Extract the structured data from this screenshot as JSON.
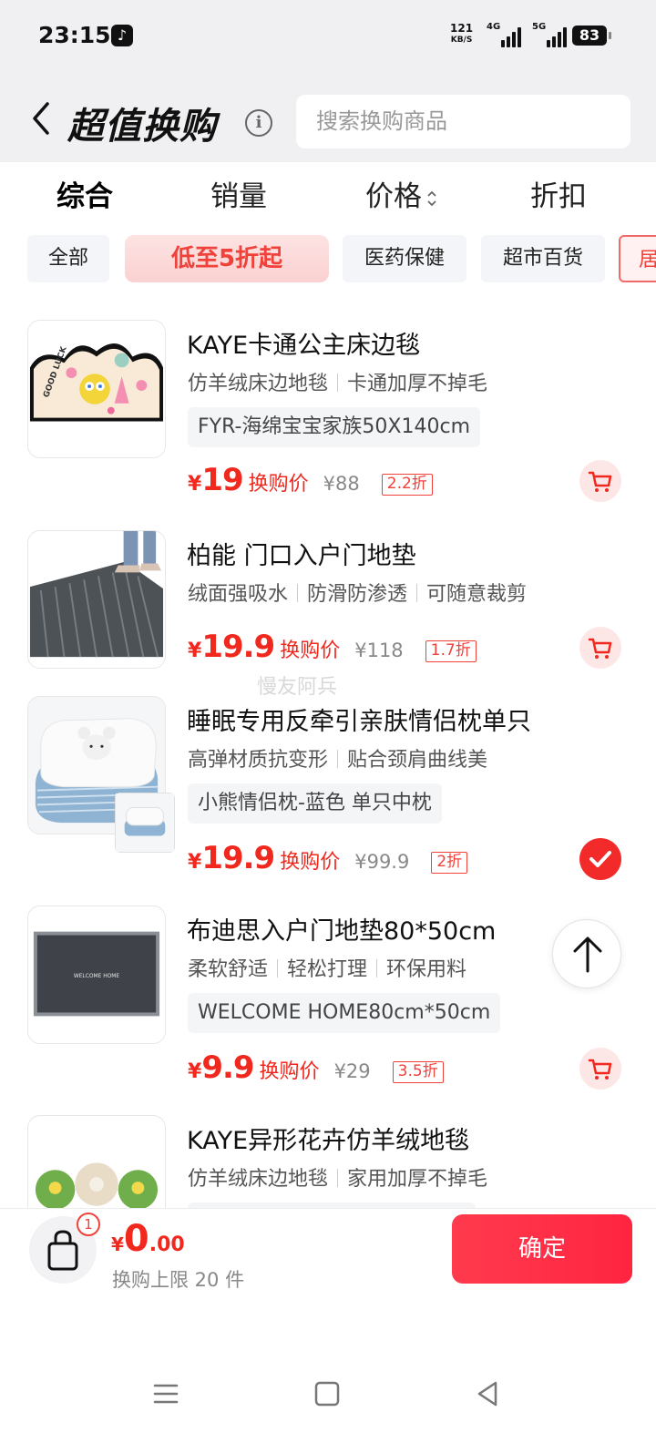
{
  "status_bar": {
    "time": "23:15",
    "net_speed_value": "121",
    "net_speed_unit": "KB/S",
    "signal1_label": "4G",
    "signal2_label": "5G",
    "battery": "83"
  },
  "header": {
    "title": "超值换购",
    "search_placeholder": "搜索换购商品"
  },
  "sort_tabs": [
    {
      "label": "综合",
      "active": true
    },
    {
      "label": "销量",
      "active": false
    },
    {
      "label": "价格",
      "active": false
    },
    {
      "label": "折扣",
      "active": false
    }
  ],
  "category_chips": [
    {
      "label": "全部"
    },
    {
      "label": "低至5折起"
    },
    {
      "label": "医药保健"
    },
    {
      "label": "超市百货"
    },
    {
      "label": "居"
    }
  ],
  "products": [
    {
      "title": "KAYE卡通公主床边毯",
      "tags": [
        "仿羊绒床边地毯",
        "卡通加厚不掉毛"
      ],
      "variant": "FYR-海绵宝宝家族50X140cm",
      "price_symbol": "¥",
      "price": "19",
      "price_label": "换购价",
      "original_price": "¥88",
      "discount": "2.2折",
      "selected": false
    },
    {
      "title": "柏能 门口入户门地垫",
      "tags": [
        "绒面强吸水",
        "防滑防渗透",
        "可随意裁剪"
      ],
      "variant": "",
      "price_symbol": "¥",
      "price": "19.9",
      "price_label": "换购价",
      "original_price": "¥118",
      "discount": "1.7折",
      "selected": false
    },
    {
      "title": "睡眠专用反牵引亲肤情侣枕单只",
      "tags": [
        "高弹材质抗变形",
        "贴合颈肩曲线美"
      ],
      "variant": "小熊情侣枕-蓝色 单只中枕",
      "price_symbol": "¥",
      "price": "19.9",
      "price_label": "换购价",
      "original_price": "¥99.9",
      "discount": "2折",
      "selected": true
    },
    {
      "title": "布迪思入户门地垫80*50cm",
      "tags": [
        "柔软舒适",
        "轻松打理",
        "环保用料"
      ],
      "variant": "WELCOME HOME80cm*50cm",
      "image_text": "WELCOME HOME",
      "price_symbol": "¥",
      "price": "9.9",
      "price_label": "换购价",
      "original_price": "¥29",
      "discount": "3.5折",
      "selected": false
    },
    {
      "title": "KAYE异形花卉仿羊绒地毯",
      "tags": [
        "仿羊绒床边地毯",
        "家用加厚不掉毛"
      ],
      "variant": "",
      "selected": false
    }
  ],
  "thumb_texts": {
    "good_luck": "GOOD LUCK"
  },
  "watermark": "慢友阿兵",
  "bottom_bar": {
    "badge_count": "1",
    "total_symbol": "¥",
    "total_int": "0",
    "total_dec": ".00",
    "limit_text": "换购上限 20 件",
    "confirm_label": "确定"
  },
  "colors": {
    "accent": "#f0281e",
    "confirm_button": "#ff2d46",
    "chip_bg": "#f3f5f8"
  }
}
